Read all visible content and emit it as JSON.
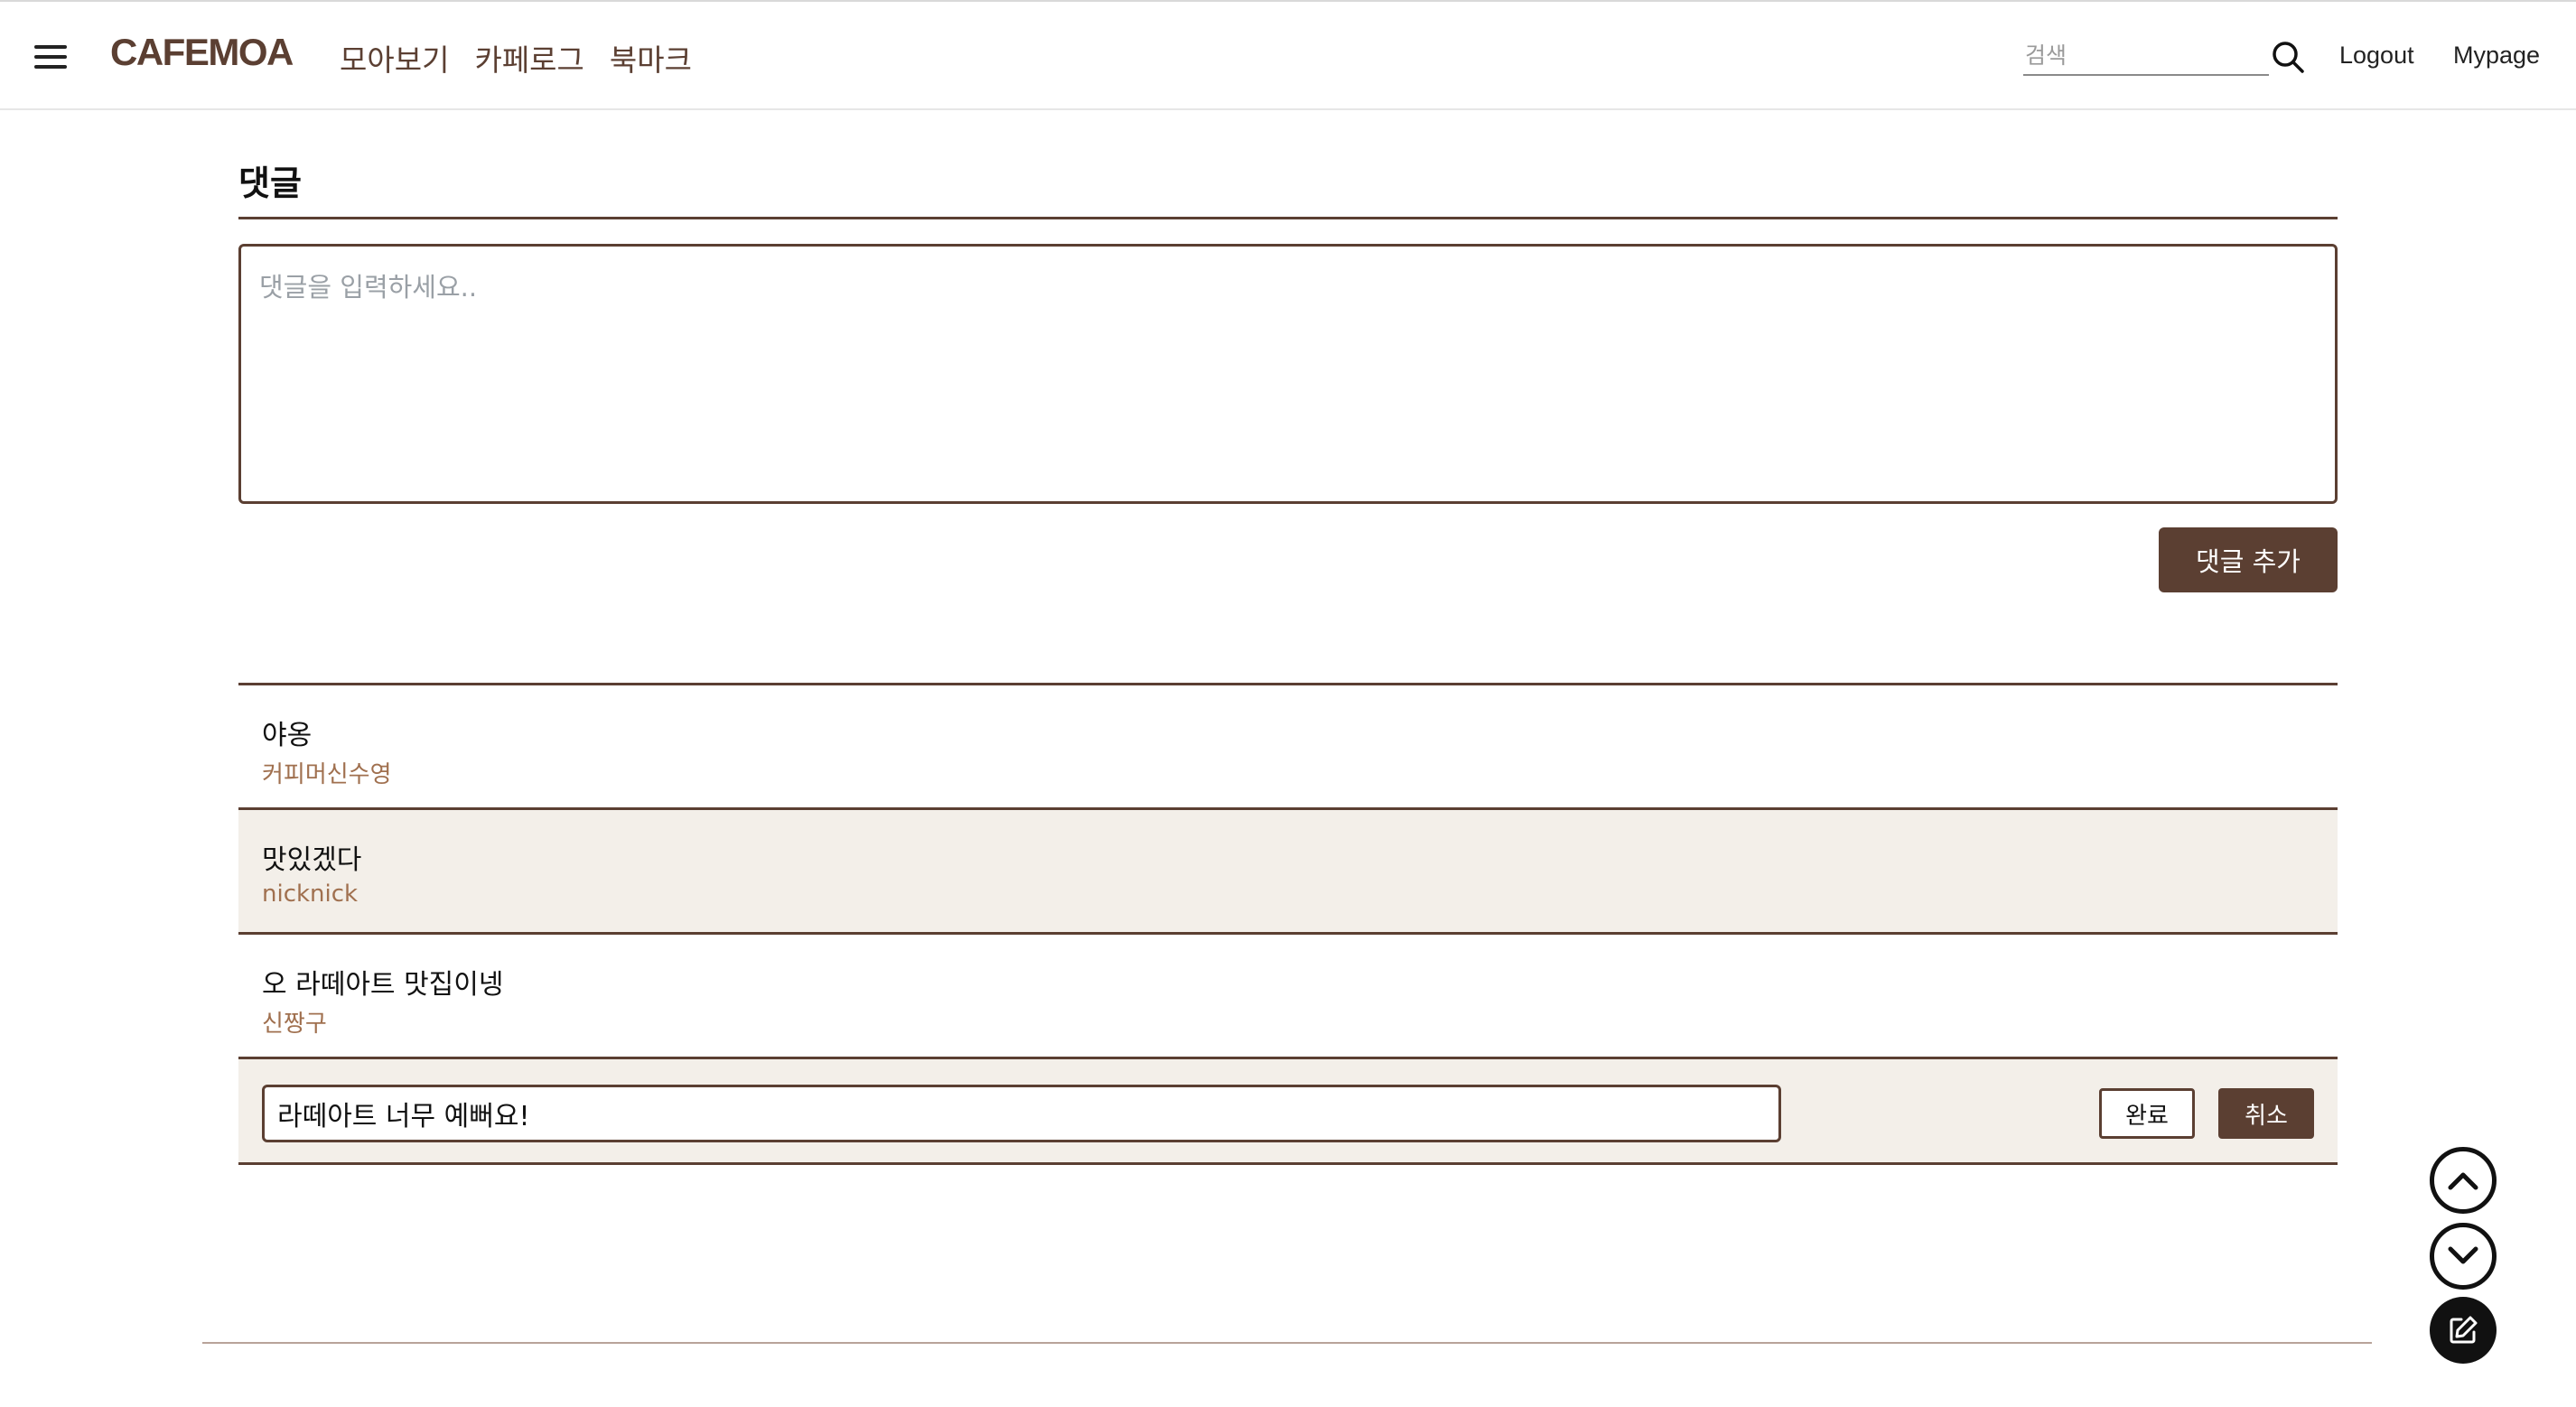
{
  "header": {
    "logo": "CAFEMOA",
    "nav": [
      "모아보기",
      "카페로그",
      "북마크"
    ],
    "search_placeholder": "검색",
    "logout_label": "Logout",
    "mypage_label": "Mypage"
  },
  "comments": {
    "title": "댓글",
    "input_placeholder": "댓글을 입력하세요..",
    "add_label": "댓글 추가",
    "items": [
      {
        "text": "야옹",
        "author": "커피머신수영"
      },
      {
        "text": "맛있겠다",
        "author": "nicknick"
      },
      {
        "text": "오 라떼아트 맛집이넹",
        "author": "신짱구"
      }
    ],
    "edit": {
      "value": "라떼아트 너무 예뻐요!",
      "done_label": "완료",
      "cancel_label": "취소"
    }
  },
  "colors": {
    "accent": "#5b3f32",
    "author": "#a0704f",
    "row_shade": "#f3efe9"
  },
  "icons": [
    "hamburger-menu-icon",
    "search-icon",
    "scroll-up-icon",
    "scroll-down-icon",
    "edit-icon"
  ]
}
